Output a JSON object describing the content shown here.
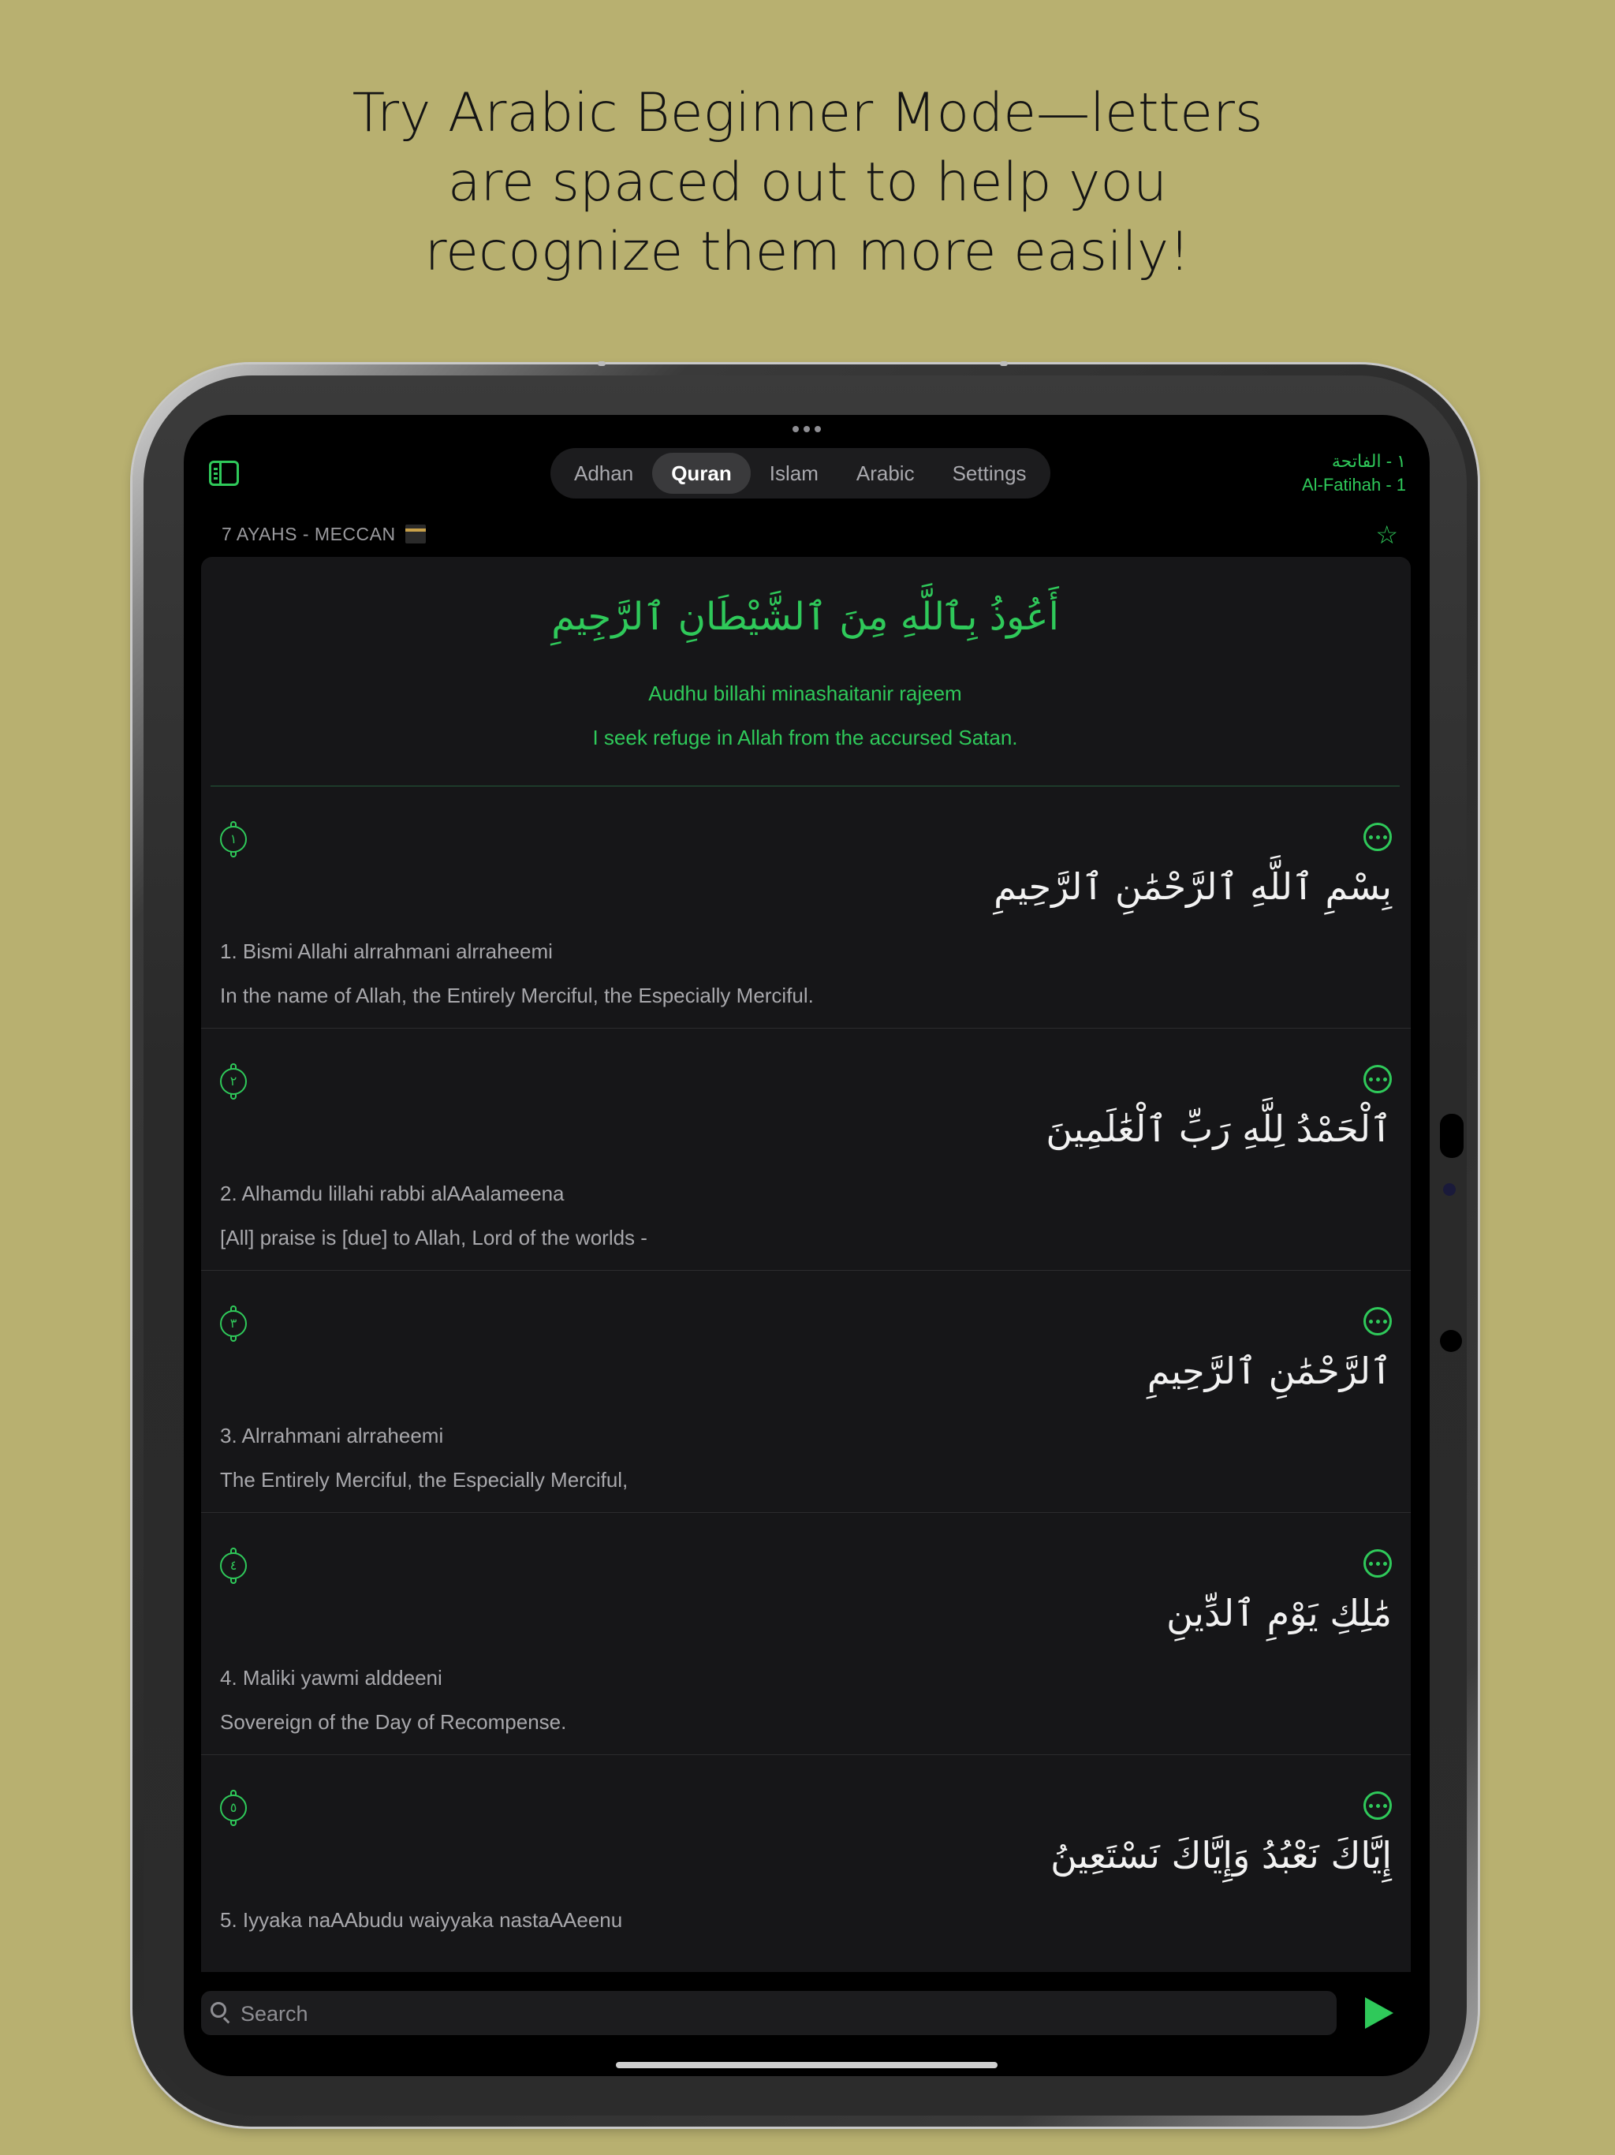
{
  "promo": {
    "line1": "Try Arabic Beginner Mode—letters",
    "line2": "are spaced out to help you",
    "line3": "recognize them more easily!"
  },
  "nav": {
    "tabs": [
      {
        "label": "Adhan"
      },
      {
        "label": "Quran",
        "active": true
      },
      {
        "label": "Islam"
      },
      {
        "label": "Arabic"
      },
      {
        "label": "Settings"
      }
    ]
  },
  "surah": {
    "arabic_title": "١ - الفاتحة",
    "english_title": "Al-Fatihah - 1",
    "meta": "7 AYAHS - MECCAN"
  },
  "istiadha": {
    "arabic": "أَعُوذُ بِٱللَّهِ مِنَ ٱلشَّيْطَانِ ٱلرَّجِيمِ",
    "transliteration": "Audhu billahi minashaitanir rajeem",
    "translation": "I seek refuge in Allah from the accursed Satan."
  },
  "ayahs": [
    {
      "number": "١",
      "arabic": "بِسْمِ ٱللَّهِ ٱلرَّحْمَٰنِ ٱلرَّحِيمِ",
      "transliteration": "1. Bismi Allahi alrrahmani alrraheemi",
      "translation": "In the name of Allah, the Entirely Merciful, the Especially Merciful."
    },
    {
      "number": "٢",
      "arabic": "ٱلْحَمْدُ لِلَّهِ رَبِّ ٱلْعَٰلَمِينَ",
      "transliteration": "2. Alhamdu lillahi rabbi alAAalameena",
      "translation": "[All] praise is [due] to Allah, Lord of the worlds -"
    },
    {
      "number": "٣",
      "arabic": "ٱلرَّحْمَٰنِ ٱلرَّحِيمِ",
      "transliteration": "3. Alrrahmani alrraheemi",
      "translation": "The Entirely Merciful, the Especially Merciful,"
    },
    {
      "number": "٤",
      "arabic": "مَٰلِكِ يَوْمِ ٱلدِّينِ",
      "transliteration": "4. Maliki yawmi alddeeni",
      "translation": "Sovereign of the Day of Recompense."
    },
    {
      "number": "٥",
      "arabic": "إِيَّاكَ نَعْبُدُ وَإِيَّاكَ نَسْتَعِينُ",
      "transliteration": "5. Iyyaka naAAbudu waiyyaka nastaAAeenu",
      "translation": ""
    }
  ],
  "search": {
    "placeholder": "Search"
  },
  "colors": {
    "accent": "#2fc95a",
    "background": "#b8b070",
    "screen": "#000000",
    "card": "#161618"
  },
  "icons": {
    "sidebar": "sidebar-icon",
    "star": "star-icon",
    "more": "ellipsis-circle-icon",
    "search": "search-icon",
    "play": "play-icon"
  }
}
